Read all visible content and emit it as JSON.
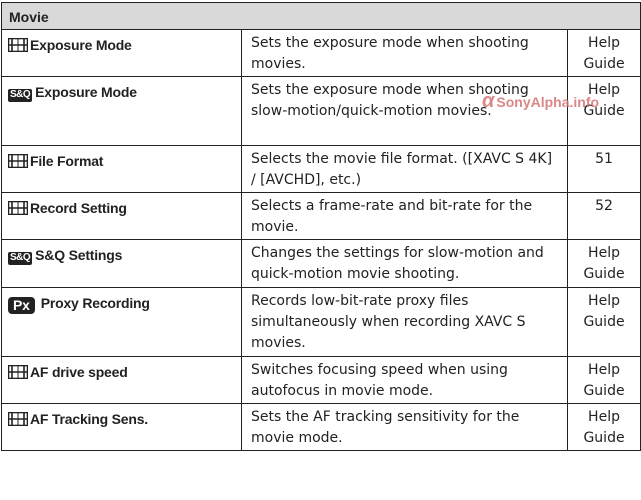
{
  "table": {
    "header": "Movie",
    "rows": [
      {
        "icon": "movie-icon",
        "name": "Exposure Mode",
        "desc": "Sets the exposure mode when shooting movies.",
        "page": "Help Guide"
      },
      {
        "icon": "sq-icon",
        "icon_text": "S&Q",
        "name": "Exposure Mode",
        "desc": "Sets the exposure mode when shooting slow-motion/quick-motion movies.",
        "page": "Help Guide"
      },
      {
        "icon": "movie-icon",
        "name": "File Format",
        "desc": "Selects the movie file format. ([XAVC S 4K] / [AVCHD], etc.)",
        "page": "51"
      },
      {
        "icon": "movie-icon",
        "name": "Record Setting",
        "desc": "Selects a frame-rate and bit-rate for the movie.",
        "page": "52"
      },
      {
        "icon": "sq-icon",
        "icon_text": "S&Q",
        "name": "S&Q Settings",
        "desc": "Changes the settings for slow-motion and quick-motion movie shooting.",
        "page": "Help Guide"
      },
      {
        "icon": "px-icon",
        "icon_text": "Px",
        "name": "Proxy Recording",
        "desc": "Records low-bit-rate proxy files simultaneously when recording XAVC S movies.",
        "page": "Help Guide"
      },
      {
        "icon": "movie-icon",
        "name": "AF drive speed",
        "desc": "Switches focusing speed when using autofocus in movie mode.",
        "page": "Help Guide"
      },
      {
        "icon": "movie-icon",
        "name": "AF Tracking Sens.",
        "desc": "Sets the AF tracking sensitivity for the movie mode.",
        "page": "Help Guide"
      }
    ]
  },
  "watermark": {
    "symbol": "α",
    "text": "SonyAlpha.info",
    "color": "#d47373"
  }
}
